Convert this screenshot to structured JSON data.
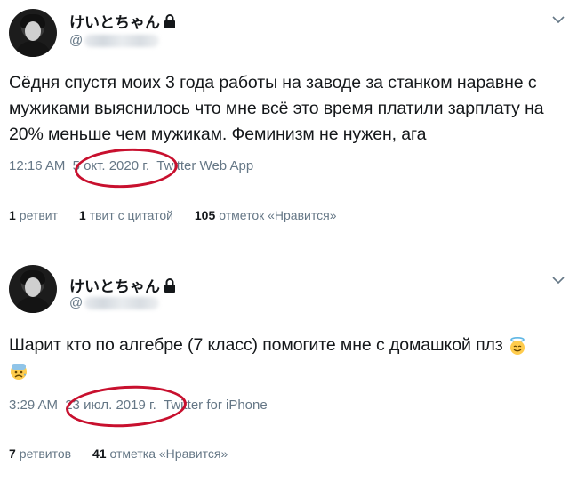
{
  "tweets": [
    {
      "display_name": "けいとちゃん",
      "handle_prefix": "@",
      "text": "Сёдня спустя моих 3 года работы на заводе за станком наравне с мужиками выяснилось что мне всё это время платили зарплату на 20% меньше чем мужикам. Феминизм не нужен, ага",
      "time": "12:16 AM",
      "date": "5 окт. 2020 г.",
      "source": "Twitter Web App",
      "stats": [
        {
          "count": "1",
          "label": "ретвит"
        },
        {
          "count": "1",
          "label": "твит с цитатой"
        },
        {
          "count": "105",
          "label": "отметок «Нравится»"
        }
      ]
    },
    {
      "display_name": "けいとちゃん",
      "handle_prefix": "@",
      "text": "Шарит кто по алгебре (7 класс) помогите мне с домашкой плз",
      "time": "3:29 AM",
      "date": "23 июл. 2019 г.",
      "source": "Twitter for iPhone",
      "stats": [
        {
          "count": "7",
          "label": "ретвитов"
        },
        {
          "count": "41",
          "label": "отметка «Нравится»"
        }
      ]
    }
  ],
  "icons": [
    "avatar",
    "lock-icon",
    "chevron-down-icon",
    "angel-emoji-icon",
    "worried-emoji-icon"
  ],
  "colors": {
    "annotation_circle": "#c8102e",
    "muted_text": "#657786",
    "main_text": "#14171a"
  }
}
